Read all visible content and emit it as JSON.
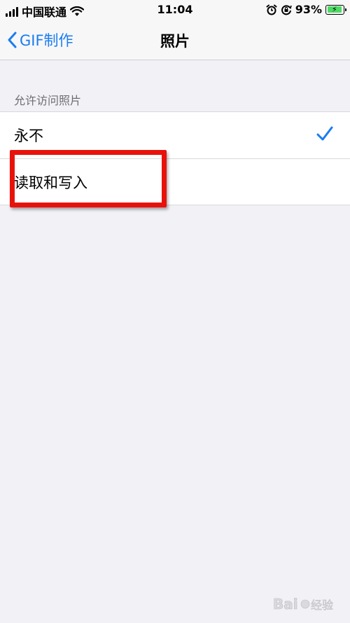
{
  "status_bar": {
    "carrier": "中国联通",
    "time": "11:04",
    "battery_percent": "93%",
    "battery_level": 0.93
  },
  "nav": {
    "back_label": "GIF制作",
    "title": "照片"
  },
  "section": {
    "header": "允许访问照片",
    "options": [
      {
        "label": "永不",
        "selected": true
      },
      {
        "label": "读取和写入",
        "selected": false
      }
    ]
  },
  "colors": {
    "accent": "#1a7cf2",
    "highlight": "#e8120c",
    "battery_fill": "#4cd964"
  },
  "icons": [
    "signal-icon",
    "wifi-icon",
    "alarm-icon",
    "orientation-lock-icon",
    "battery-icon",
    "chevron-left-icon",
    "checkmark-icon"
  ]
}
